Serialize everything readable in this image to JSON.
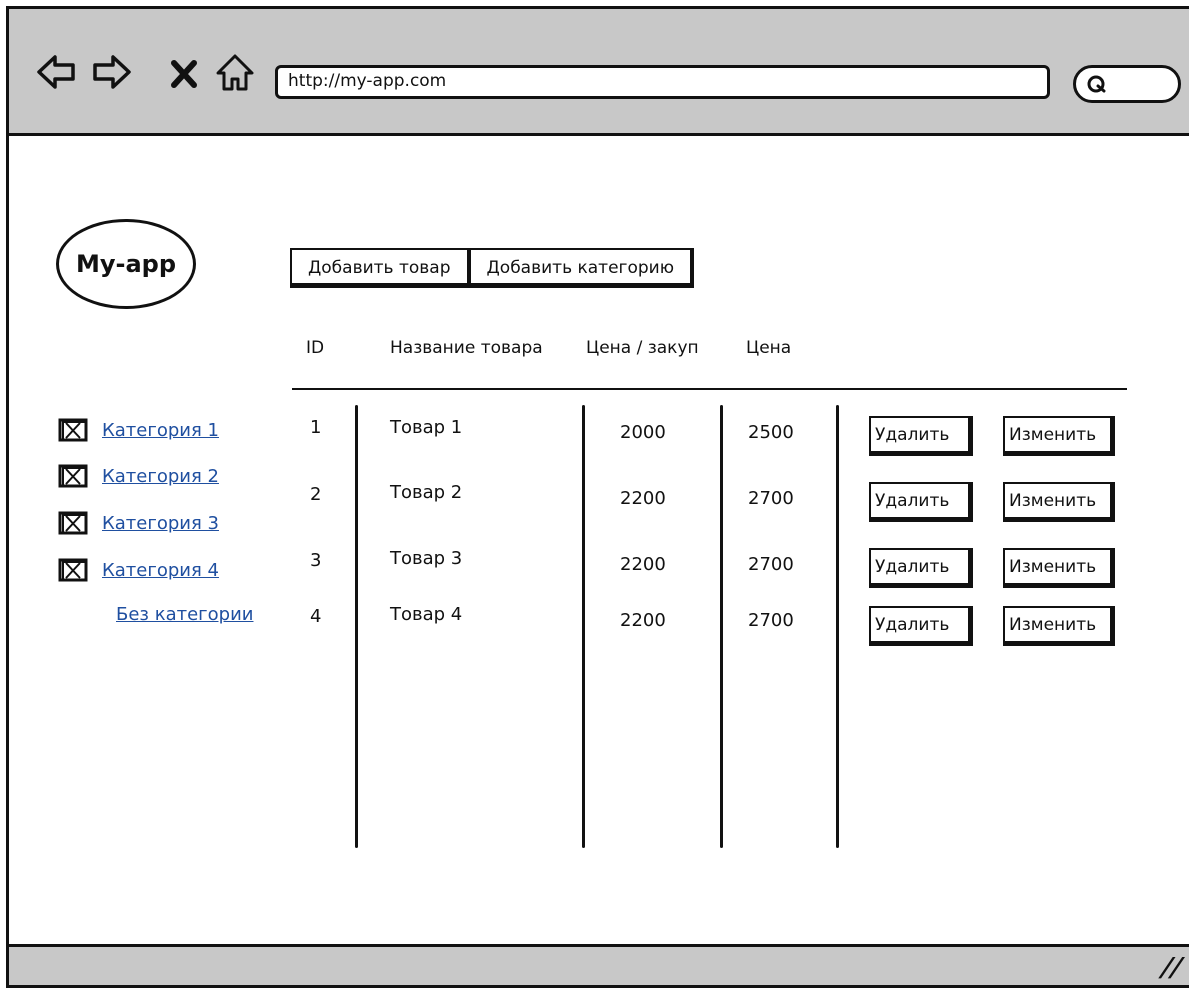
{
  "browser": {
    "url": "http://my-app.com",
    "nav_icons": [
      "back-arrow-icon",
      "forward-arrow-icon",
      "close-icon",
      "home-icon"
    ],
    "search_icon": "search-icon"
  },
  "app": {
    "logo": "My-app"
  },
  "categories": [
    {
      "label": "Категория 1",
      "icon": "image-placeholder-icon"
    },
    {
      "label": "Категория 2",
      "icon": "image-placeholder-icon"
    },
    {
      "label": "Категория 3",
      "icon": "image-placeholder-icon"
    },
    {
      "label": "Категория 4",
      "icon": "image-placeholder-icon"
    },
    {
      "label": "Без категории",
      "icon": ""
    }
  ],
  "toolbar": {
    "add_product": "Добавить товар",
    "add_category": "Добавить категорию"
  },
  "table": {
    "headers": [
      "ID",
      "Название товара",
      "Цена / закуп",
      "Цена"
    ],
    "rows": [
      {
        "id": "1",
        "name": "Товар 1",
        "cost": "2000",
        "price": "2500",
        "delete": "Удалить",
        "edit": "Изменить"
      },
      {
        "id": "2",
        "name": "Товар 2",
        "cost": "2200",
        "price": "2700",
        "delete": "Удалить",
        "edit": "Изменить"
      },
      {
        "id": "3",
        "name": "Товар 3",
        "cost": "2200",
        "price": "2700",
        "delete": "Удалить",
        "edit": "Изменить"
      },
      {
        "id": "4",
        "name": "Товар 4",
        "cost": "2200",
        "price": "2700",
        "delete": "Удалить",
        "edit": "Изменить"
      }
    ]
  },
  "colors": {
    "chrome": "#c8c8c8",
    "link": "#1f4fa0"
  }
}
